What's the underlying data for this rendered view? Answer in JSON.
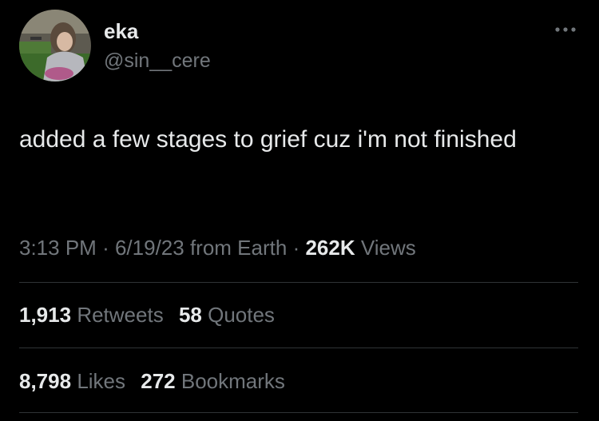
{
  "author": {
    "name": "eka",
    "handle": "@sin__cere"
  },
  "tweet": {
    "text": "added a few stages to grief cuz i'm not finished",
    "time": "3:13 PM",
    "date": "6/19/23",
    "source": "from Earth",
    "views_count": "262K",
    "views_label": "Views",
    "separator": "·"
  },
  "stats": {
    "retweets_count": "1,913",
    "retweets_label": "Retweets",
    "quotes_count": "58",
    "quotes_label": "Quotes",
    "likes_count": "8,798",
    "likes_label": "Likes",
    "bookmarks_count": "272",
    "bookmarks_label": "Bookmarks"
  },
  "icons": {
    "more": "more-options-icon"
  },
  "colors": {
    "background": "#000000",
    "primary_text": "#e7e9ea",
    "secondary_text": "#71767b",
    "divider": "#2f3336"
  }
}
